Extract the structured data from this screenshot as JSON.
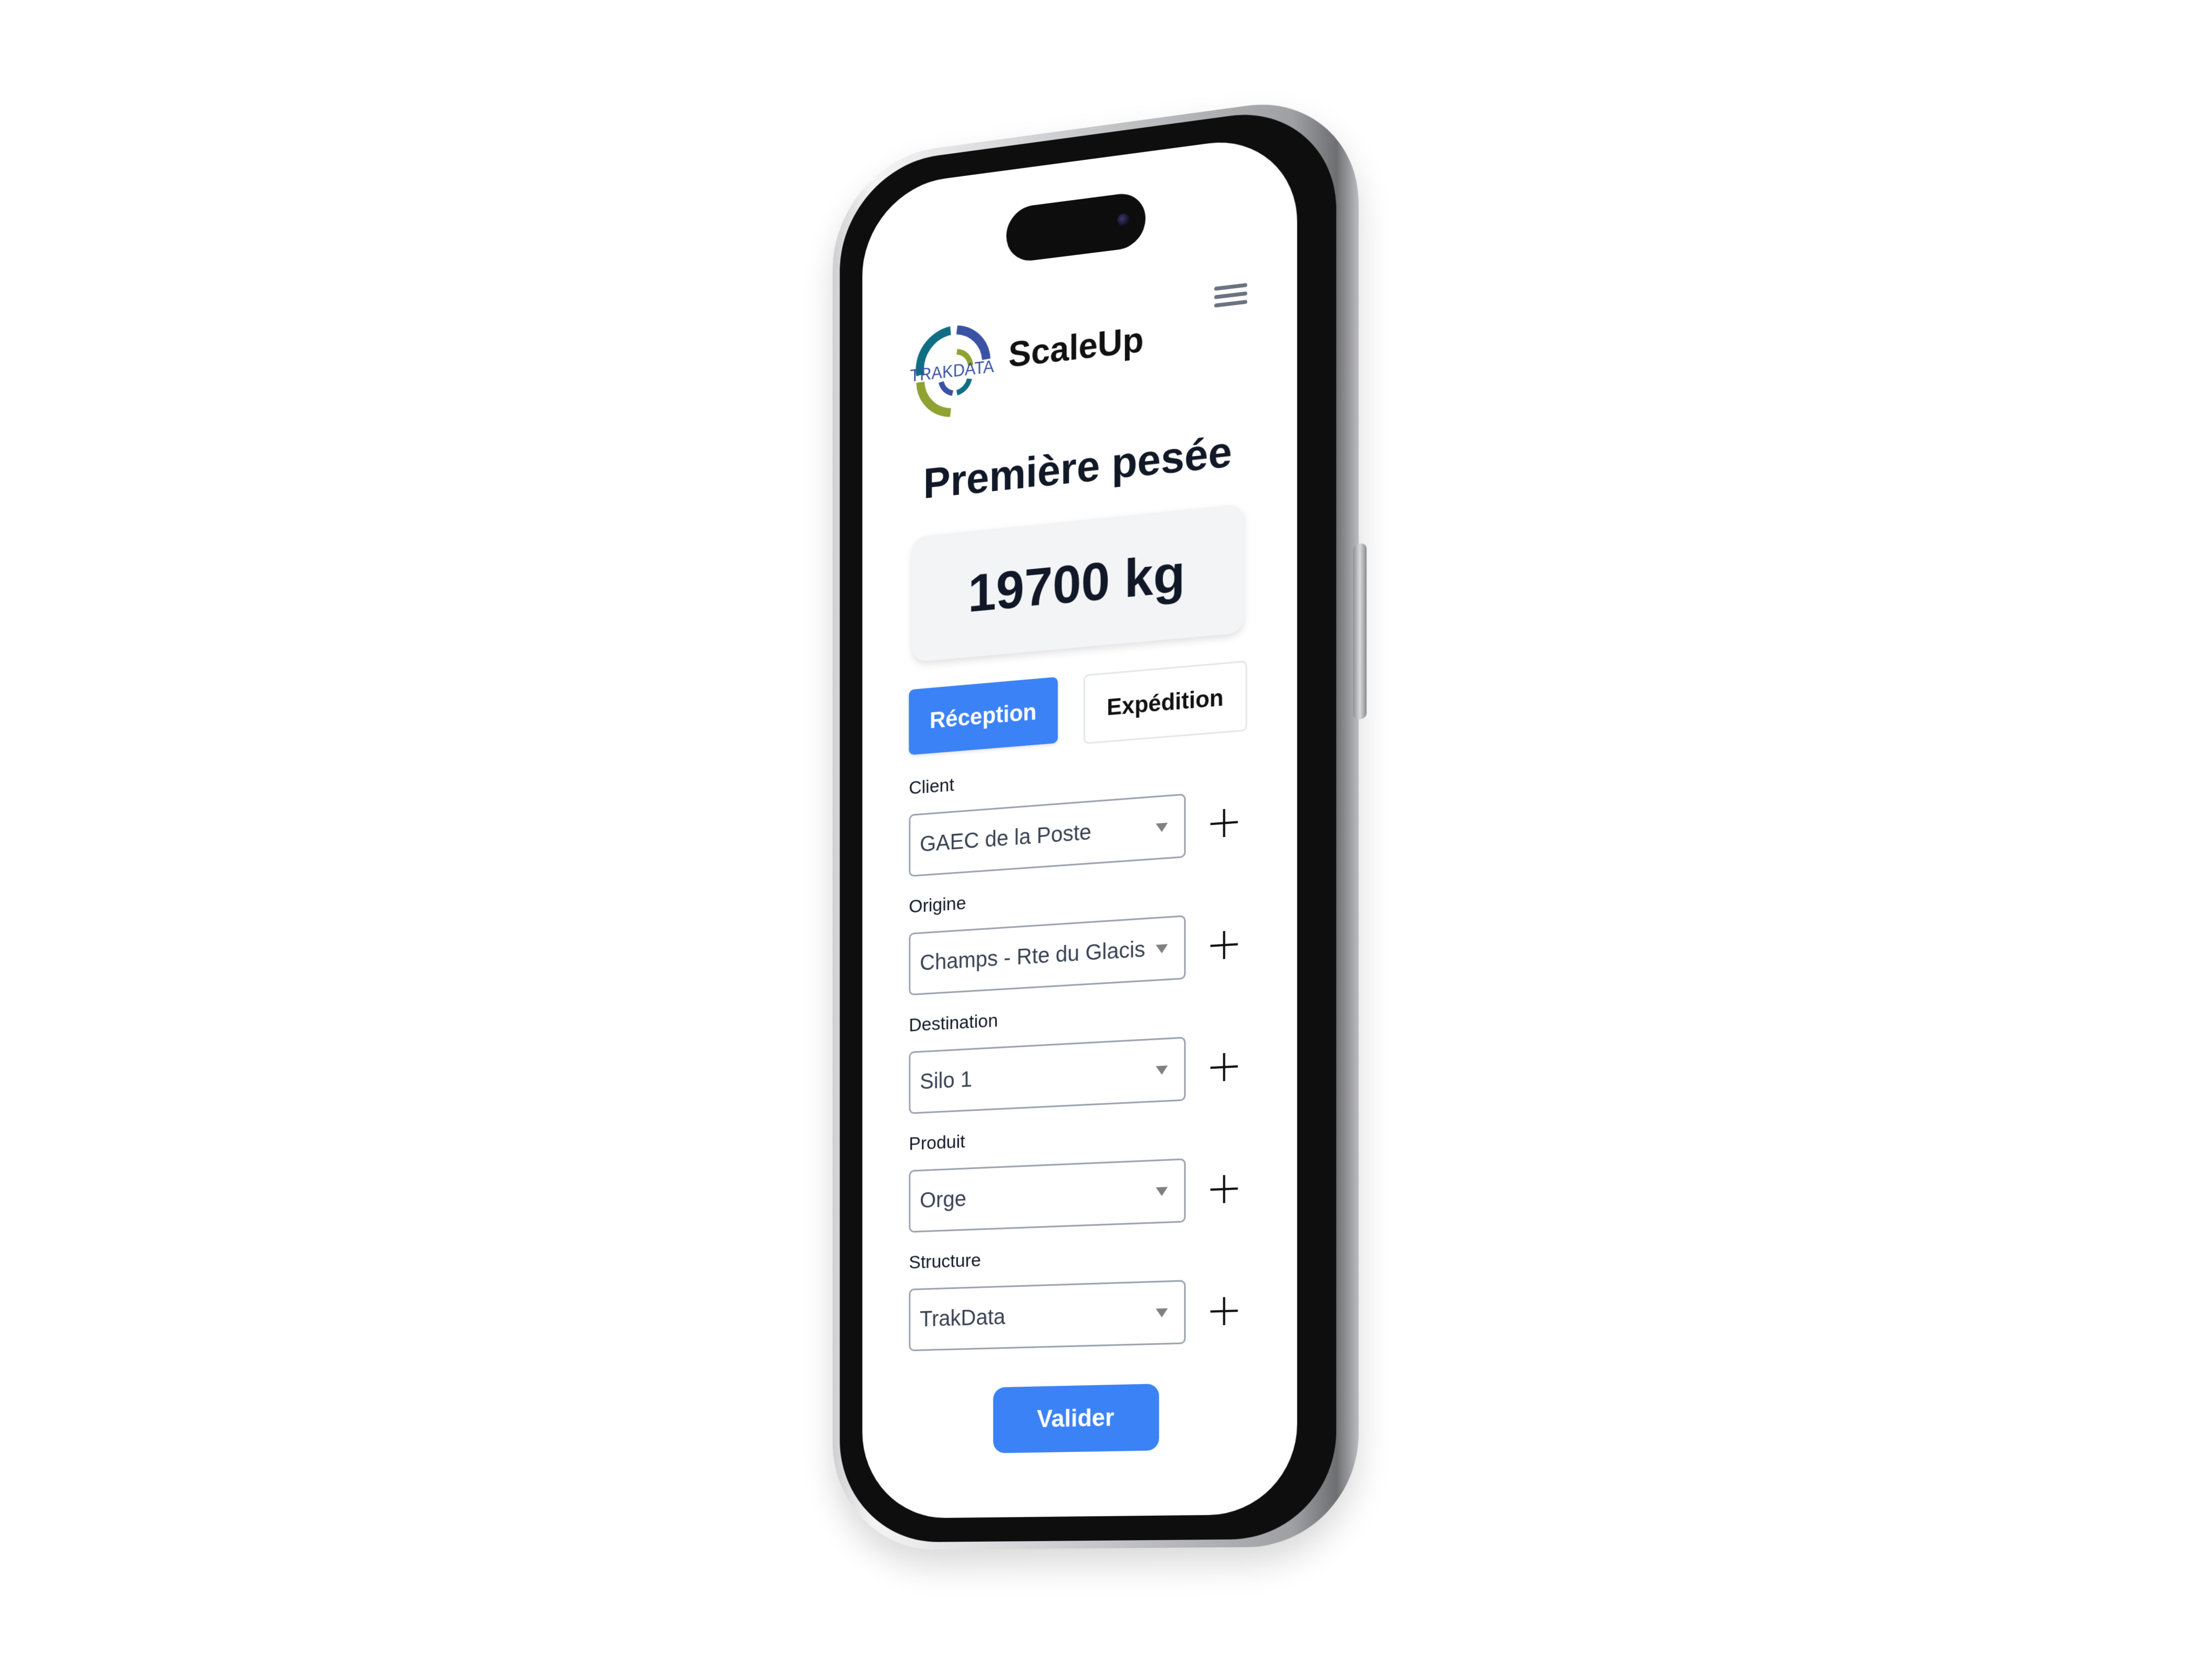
{
  "header": {
    "logo_text": "TRAKDATA",
    "brand": "ScaleUp",
    "menu_icon": "hamburger-menu-icon"
  },
  "page": {
    "title": "Première pesée",
    "weight": "19700 kg"
  },
  "modes": {
    "reception": "Réception",
    "expedition": "Expédition",
    "selected": "Réception"
  },
  "fields": [
    {
      "label": "Client",
      "value": "GAEC de la Poste"
    },
    {
      "label": "Origine",
      "value": "Champs - Rte du Glacis"
    },
    {
      "label": "Destination",
      "value": "Silo 1"
    },
    {
      "label": "Produit",
      "value": "Orge"
    },
    {
      "label": "Structure",
      "value": "TrakData"
    }
  ],
  "actions": {
    "submit": "Valider",
    "add_icon": "plus-icon"
  },
  "colors": {
    "accent": "#3b82f6",
    "logo_teal": "#0f6e85",
    "logo_blue": "#3a52a3",
    "logo_green": "#8fa232"
  }
}
